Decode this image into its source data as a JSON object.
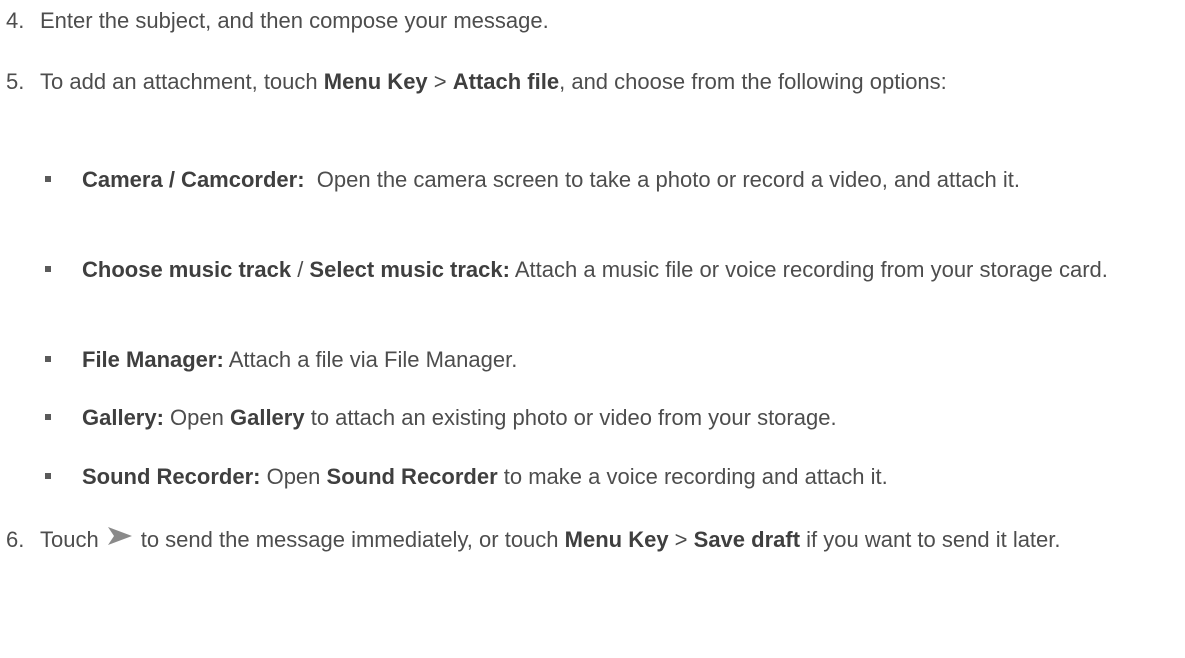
{
  "steps": [
    {
      "num": "4.",
      "text": "Enter the subject, and then compose your message."
    },
    {
      "num": "5.",
      "t1": "To add an attachment, touch ",
      "b1": "Menu Key",
      "t2": " > ",
      "b2": "Attach file",
      "t3": ", and choose from the following options:",
      "bullets": [
        {
          "b1": "Camera / Camcorder:",
          "t1": "  Open the camera screen to take a photo or record a video, and attach it."
        },
        {
          "b1": "Choose music track",
          "t1": " / ",
          "b2": "Select music track:",
          "t2": " Attach a music file or voice recording from your storage card."
        },
        {
          "b1": "File Manager:",
          "t1": " Attach a file via File Manager."
        },
        {
          "b1": "Gallery:",
          "t1": " Open ",
          "b2": "Gallery",
          "t2": " to attach an existing photo or video from your storage."
        },
        {
          "b1": "Sound Recorder:",
          "t1": " Open ",
          "b2": "Sound Recorder",
          "t2": " to make a voice recording and attach it."
        }
      ]
    },
    {
      "num": "6.",
      "t1": "Touch",
      "icon": "send-arrow-icon",
      "t2": "to send the message immediately, or touch ",
      "b1": "Menu Key",
      "t3": " > ",
      "b2": "Save draft",
      "t4": " if you want to send it later."
    }
  ],
  "colors": {
    "text": "#4d4d4d",
    "bold_text": "#3f3f3f",
    "icon": "#8a8a8a"
  }
}
